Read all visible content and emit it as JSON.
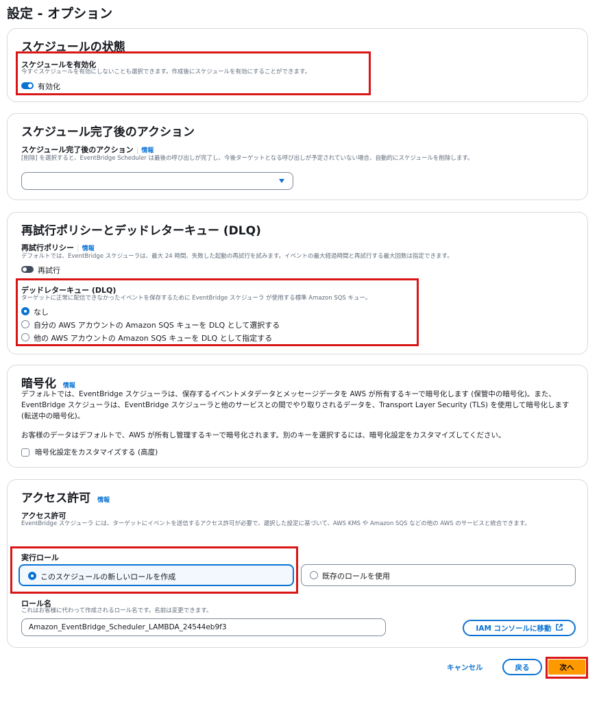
{
  "page": {
    "title": "設定 - オプション"
  },
  "schedule_state": {
    "title": "スケジュールの状態",
    "enable_label": "スケジュールを有効化",
    "enable_desc": "今すぐスケジュールを有効にしないことも選択できます。作成後にスケジュールを有効にすることができます。",
    "toggle_label": "有効化",
    "toggle_on": true
  },
  "completion": {
    "title": "スケジュール完了後のアクション",
    "field_label": "スケジュール完了後のアクション",
    "info": "情報",
    "desc": "[削除] を選択すると、EventBridge Scheduler は最後の呼び出しが完了し、今後ターゲットとなる呼び出しが予定されていない場合、自動的にスケジュールを削除します。",
    "select_value": ""
  },
  "retry": {
    "title": "再試行ポリシーとデッドレターキュー (DLQ)",
    "policy_label": "再試行ポリシー",
    "info": "情報",
    "policy_desc": "デフォルトでは、EventBridge スケジューラは、最大 24 時間、失敗した起動の再試行を試みます。イベントの最大経過時間と再試行する最大回数は指定できます。",
    "toggle_label": "再試行",
    "toggle_on": false,
    "dlq_label": "デッドレターキュー (DLQ)",
    "dlq_desc": "ターゲットに正常に配信できなかったイベントを保存するために EventBridge スケジューラ が使用する標準 Amazon SQS キュー。",
    "options": [
      "なし",
      "自分の AWS アカウントの Amazon SQS キューを DLQ として選択する",
      "他の AWS アカウントの Amazon SQS キューを DLQ として指定する"
    ],
    "selected_index": 0
  },
  "encryption": {
    "title": "暗号化",
    "info": "情報",
    "desc1": "デフォルトでは、EventBridge スケジューラは、保存するイベントメタデータとメッセージデータを AWS が所有するキーで暗号化します (保管中の暗号化)。また、EventBridge スケジューラは、EventBridge スケジューラと他のサービスとの間でやり取りされるデータを、Transport Layer Security (TLS) を使用して暗号化します (転送中の暗号化)。",
    "desc2": "お客様のデータはデフォルトで、AWS が所有し管理するキーで暗号化されます。別のキーを選択するには、暗号化設定をカスタマイズしてください。",
    "checkbox_label": "暗号化設定をカスタマイズする (高度)",
    "checked": false
  },
  "permissions": {
    "title": "アクセス許可",
    "info": "情報",
    "label": "アクセス許可",
    "desc": "EventBridge スケジューラ には、ターゲットにイベントを送信するアクセス許可が必要で、選択した設定に基づいて、AWS KMS や Amazon SQS などの他の AWS のサービスと統合できます。",
    "role_label": "実行ロール",
    "role_options": [
      "このスケジュールの新しいロールを作成",
      "既存のロールを使用"
    ],
    "role_selected_index": 0,
    "name_label": "ロール名",
    "name_desc": "これはお客様に代わって作成されるロール名です。名前は変更できます。",
    "name_value": "Amazon_EventBridge_Scheduler_LAMBDA_24544eb9f3",
    "iam_button": "IAM コンソールに移動"
  },
  "footer": {
    "cancel": "キャンセル",
    "back": "戻る",
    "next": "次へ"
  },
  "colors": {
    "accent": "#0972d3",
    "primary_button": "#ff9900",
    "highlight_box": "#d91515"
  }
}
